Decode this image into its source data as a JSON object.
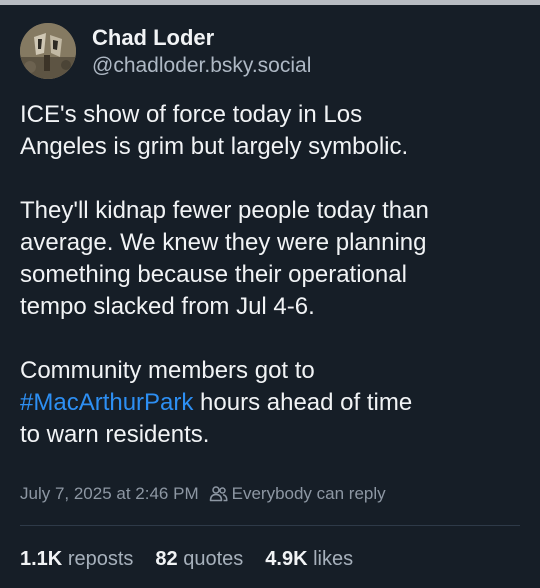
{
  "post": {
    "author": {
      "display_name": "Chad Loder",
      "handle": "@chadloder.bsky.social",
      "avatar_icon": "avatar-image"
    },
    "paragraphs": [
      {
        "lines": [
          "ICE's show of force today in Los",
          "Angeles is grim but largely symbolic."
        ]
      },
      {
        "lines": [
          "They'll kidnap fewer people today than",
          "average. We knew they were planning",
          "something because their operational",
          "tempo slacked from Jul 4-6."
        ]
      },
      {
        "line1": "Community members got to",
        "hashtag": "#MacArthurPark",
        "line2_rest": " hours ahead of time",
        "line3": "to warn residents."
      }
    ],
    "timestamp": "July 7, 2025 at 2:46 PM",
    "reply_setting": "Everybody can reply",
    "reply_setting_icon": "people-icon",
    "stats": {
      "reposts_count": "1.1K",
      "reposts_label": "reposts",
      "quotes_count": "82",
      "quotes_label": "quotes",
      "likes_count": "4.9K",
      "likes_label": "likes"
    },
    "colors": {
      "background": "#161e27",
      "text": "#f1f3f5",
      "muted": "#8d97a3",
      "link": "#2d8ff3"
    }
  }
}
